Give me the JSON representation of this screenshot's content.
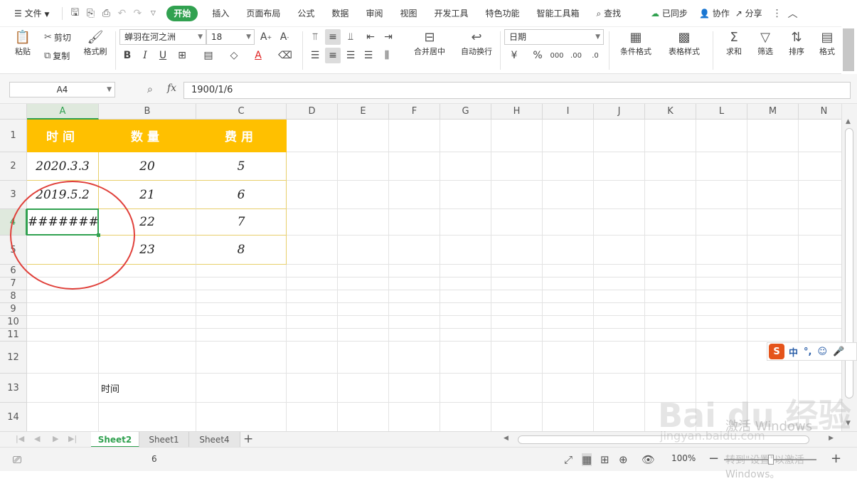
{
  "menubar": {
    "file_label": "文件",
    "tabs": [
      "开始",
      "插入",
      "页面布局",
      "公式",
      "数据",
      "审阅",
      "视图",
      "开发工具",
      "特色功能",
      "智能工具箱"
    ],
    "search_label": "查找",
    "sync_label": "已同步",
    "collab_label": "协作",
    "share_label": "分享"
  },
  "ribbon": {
    "paste_label": "粘贴",
    "cut_label": "剪切",
    "copy_label": "复制",
    "format_painter_label": "格式刷",
    "font_name": "蝉羽在河之洲",
    "font_size": "18",
    "merge_label": "合并居中",
    "wrap_label": "自动换行",
    "number_format": "日期",
    "cond_format_label": "条件格式",
    "table_style_label": "表格样式",
    "sum_label": "求和",
    "filter_label": "筛选",
    "sort_label": "排序",
    "format_label": "格式"
  },
  "formula_bar": {
    "name_box": "A4",
    "fx_label": "fx",
    "formula": "1900/1/6"
  },
  "grid": {
    "columns": [
      "A",
      "B",
      "C",
      "D",
      "E",
      "F",
      "G",
      "H",
      "I",
      "J",
      "K",
      "L",
      "M",
      "N"
    ],
    "rows": [
      "1",
      "2",
      "3",
      "4",
      "5",
      "6",
      "7",
      "8",
      "9",
      "10",
      "11",
      "12",
      "13",
      "14"
    ],
    "header_cells": [
      "时间",
      "数量",
      "费用"
    ],
    "data": [
      [
        "2020.3.3",
        "20",
        "5"
      ],
      [
        "2019.5.2",
        "21",
        "6"
      ],
      [
        "########",
        "22",
        "7"
      ],
      [
        "",
        "23",
        "8"
      ]
    ],
    "b13_text": "时间",
    "header_fill": "#ffc000",
    "selected_cell": "A4"
  },
  "ime": {
    "lang": "中",
    "punct": "°,",
    "emoji": "☺",
    "mic": "🎤"
  },
  "sheets": {
    "tabs": [
      "Sheet2",
      "Sheet1",
      "Sheet4"
    ],
    "active": "Sheet2",
    "add_label": "+"
  },
  "status": {
    "count": "6",
    "zoom": "100%"
  },
  "watermark": {
    "brand": "Bai du 经验",
    "url": "jingyan.baidu.com",
    "activate": "激活 Windows",
    "activate_hint": "转到\"设置\"以激活 Windows。"
  }
}
